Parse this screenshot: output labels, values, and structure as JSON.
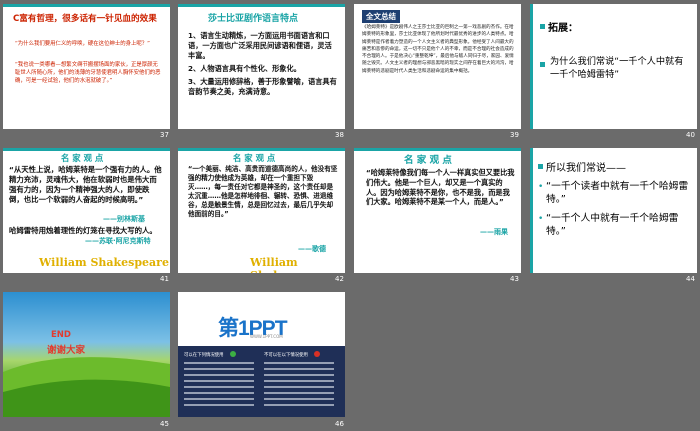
{
  "slides": {
    "s37": {
      "num": "37",
      "title": "C富有哲理，很多话有一针见血的效果",
      "q1": "“为什么我们要用仁义的呼唤，硬在这位绅士的身上呢？”",
      "q2": "“我也说一类哪看—想繁文缛节搬摆场面的家伙，正是厚颜无耻世人所随心所，他们的浅薄的牙慧使君明人胸怀安他们的恶确，可是一经试验，他们的水泡就破了。”"
    },
    "s38": {
      "num": "38",
      "title": "莎士比亚剧作语言特点",
      "items": [
        "1、语言生动精炼，一方面运用书面语言和口语，一方面也广泛采用民间谚语和俚语，灵活丰富。",
        "2、人物语言具有个性化、形象化。",
        "3、大量运用修辞格，善于形象譬喻，语言具有音韵节奏之美，充满诗意。"
      ]
    },
    "s39": {
      "num": "39",
      "tag": "全文总结",
      "text": "《哈姆莱特》是欧剧伟人之王莎士比亚的巨制之一第—戏悲剧的杰作。在哈姆莱特的形象里，莎士比亚体现了他所划时代最优秀的进步的人类特点。哈姆莱特是作者着力塑造的一个人文主义者的典型形象。他经受了人间最大的痛苦和悲惨的命运，这一切不只是他个人的不幸，而是不合理的社会造成的不合理的人。于是他决心“重整乾坤”，最后他与敌人同归于尽，家园、爱情随之毁灭。人文主义者的理想与邪恶黑暗的现实之间存在着巨大的鸿沟，哈姆莱特的悲剧是时代人类生活和悲剧命运的集中概括。"
    },
    "s40": {
      "num": "40",
      "h": "拓展：",
      "body": "为什么我们常说“一千个人中就有一千个哈姆雷特”"
    },
    "s41": {
      "num": "41",
      "title": "名 家 观 点",
      "q": "“从天性上说，哈姆莱特是一个强有力的人。他精力充沛，灵魂伟大，他在软弱时也是伟大而强有力的，因为一个精神强大的人，即使跌倒，也比一个软弱的人奋起的时候高明。”",
      "a1": "——别林斯基",
      "q2": "哈姆雷特用烛着理性的灯笼在寻找大写的人。",
      "a2": "——苏联·阿尼克斯特",
      "ws": "William Shakespeare"
    },
    "s42": {
      "num": "42",
      "title": "名 家 观 点",
      "q": "“一个美丽、纯洁、高贵而道德高尚的人，他没有坚强的精力使他成为英雄，却在一个重担下毁灭……，每一责任对它都是神圣的，这个责任却是太沉重……他是怎样地徘徊、辗转、恐惧、进退维谷，总是触景生情，总是回忆过去，最后几乎失却他面前的目。”",
      "a": "——歌德",
      "ws": "William Shakespeare"
    },
    "s43": {
      "num": "43",
      "title": "名 家 观 点",
      "q": "“哈姆莱特像我们每一个人一样真实但又要比我们伟大。他是一个巨人，却又是一个真实的人。因为哈姆莱特不是你，也不是我，而是我们大家。哈姆莱特不是某一个人，而是人。”",
      "a": "——雨果"
    },
    "s44": {
      "num": "44",
      "l1": "所以我们常说——",
      "l2": "“一千个读者中就有一千个哈姆雷特。”",
      "l3": "“一千个人中就有一千个哈姆雷特。”"
    },
    "s45": {
      "num": "45",
      "end": "END",
      "thanks": "谢谢大家"
    },
    "s46": {
      "num": "46",
      "logo": "第1PPT",
      "sub": "WWW.1PPT.COM",
      "left": "可以在下列情况使用",
      "right": "不可以在以下情况使用"
    }
  }
}
